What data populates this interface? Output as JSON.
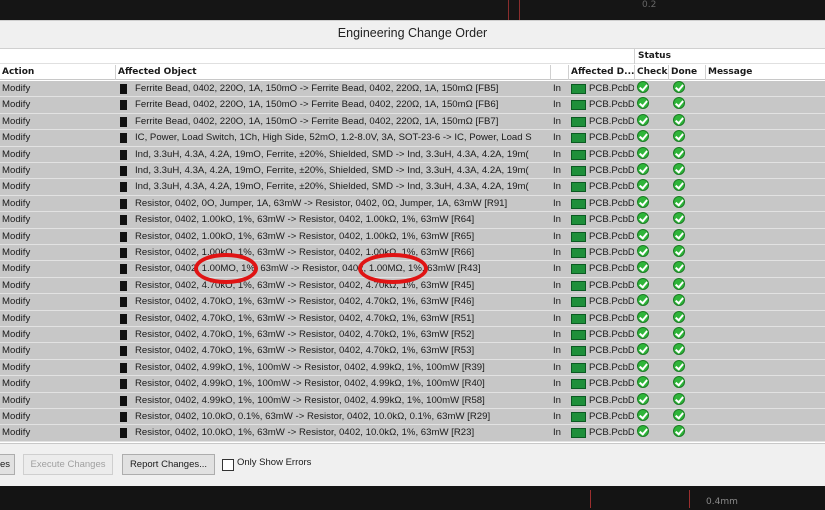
{
  "dialog": {
    "title": "Engineering Change Order",
    "header": {
      "status_group": "Status",
      "action": "Action",
      "affected_object": "Affected Object",
      "affected_document": "Affected D...",
      "check": "Check",
      "done": "Done",
      "message": "Message"
    },
    "rows": [
      {
        "action": "Modify",
        "object": "Ferrite Bead, 0402, 220O, 1A, 150mO -> Ferrite Bead, 0402, 220Ω, 1A, 150mΩ [FB5]",
        "in": "In",
        "doc": "PCB.PcbD"
      },
      {
        "action": "Modify",
        "object": "Ferrite Bead, 0402, 220O, 1A, 150mO -> Ferrite Bead, 0402, 220Ω, 1A, 150mΩ [FB6]",
        "in": "In",
        "doc": "PCB.PcbD"
      },
      {
        "action": "Modify",
        "object": "Ferrite Bead, 0402, 220O, 1A, 150mO -> Ferrite Bead, 0402, 220Ω, 1A, 150mΩ [FB7]",
        "in": "In",
        "doc": "PCB.PcbD"
      },
      {
        "action": "Modify",
        "object": "IC, Power, Load Switch, 1Ch, High Side, 52mO, 1.2-8.0V, 3A, SOT-23-6 -> IC, Power, Load S",
        "in": "In",
        "doc": "PCB.PcbD"
      },
      {
        "action": "Modify",
        "object": "Ind, 3.3uH, 4.3A, 4.2A, 19mO, Ferrite, ±20%, Shielded, SMD -> Ind, 3.3uH, 4.3A, 4.2A, 19m(",
        "in": "In",
        "doc": "PCB.PcbD"
      },
      {
        "action": "Modify",
        "object": "Ind, 3.3uH, 4.3A, 4.2A, 19mO, Ferrite, ±20%, Shielded, SMD -> Ind, 3.3uH, 4.3A, 4.2A, 19m(",
        "in": "In",
        "doc": "PCB.PcbD"
      },
      {
        "action": "Modify",
        "object": "Ind, 3.3uH, 4.3A, 4.2A, 19mO, Ferrite, ±20%, Shielded, SMD -> Ind, 3.3uH, 4.3A, 4.2A, 19m(",
        "in": "In",
        "doc": "PCB.PcbD"
      },
      {
        "action": "Modify",
        "object": "Resistor, 0402, 0O, Jumper, 1A, 63mW -> Resistor, 0402, 0Ω, Jumper, 1A, 63mW [R91]",
        "in": "In",
        "doc": "PCB.PcbD"
      },
      {
        "action": "Modify",
        "object": "Resistor, 0402, 1.00kO, 1%, 63mW -> Resistor, 0402, 1.00kΩ, 1%, 63mW [R64]",
        "in": "In",
        "doc": "PCB.PcbD"
      },
      {
        "action": "Modify",
        "object": "Resistor, 0402, 1.00kO, 1%, 63mW -> Resistor, 0402, 1.00kΩ, 1%, 63mW [R65]",
        "in": "In",
        "doc": "PCB.PcbD"
      },
      {
        "action": "Modify",
        "object": "Resistor, 0402, 1.00kO, 1%, 63mW -> Resistor, 0402, 1.00kΩ, 1%, 63mW [R66]",
        "in": "In",
        "doc": "PCB.PcbD"
      },
      {
        "action": "Modify",
        "object": "Resistor, 0402, 1.00MO, 1%, 63mW -> Resistor, 0402, 1.00MΩ, 1%, 63mW [R43]",
        "in": "In",
        "doc": "PCB.PcbD"
      },
      {
        "action": "Modify",
        "object": "Resistor, 0402, 4.70kO, 1%, 63mW -> Resistor, 0402, 4.70kΩ, 1%, 63mW [R45]",
        "in": "In",
        "doc": "PCB.PcbD"
      },
      {
        "action": "Modify",
        "object": "Resistor, 0402, 4.70kO, 1%, 63mW -> Resistor, 0402, 4.70kΩ, 1%, 63mW [R46]",
        "in": "In",
        "doc": "PCB.PcbD"
      },
      {
        "action": "Modify",
        "object": "Resistor, 0402, 4.70kO, 1%, 63mW -> Resistor, 0402, 4.70kΩ, 1%, 63mW [R51]",
        "in": "In",
        "doc": "PCB.PcbD"
      },
      {
        "action": "Modify",
        "object": "Resistor, 0402, 4.70kO, 1%, 63mW -> Resistor, 0402, 4.70kΩ, 1%, 63mW [R52]",
        "in": "In",
        "doc": "PCB.PcbD"
      },
      {
        "action": "Modify",
        "object": "Resistor, 0402, 4.70kO, 1%, 63mW -> Resistor, 0402, 4.70kΩ, 1%, 63mW [R53]",
        "in": "In",
        "doc": "PCB.PcbD"
      },
      {
        "action": "Modify",
        "object": "Resistor, 0402, 4.99kO, 1%, 100mW -> Resistor, 0402, 4.99kΩ, 1%, 100mW [R39]",
        "in": "In",
        "doc": "PCB.PcbD"
      },
      {
        "action": "Modify",
        "object": "Resistor, 0402, 4.99kO, 1%, 100mW -> Resistor, 0402, 4.99kΩ, 1%, 100mW [R40]",
        "in": "In",
        "doc": "PCB.PcbD"
      },
      {
        "action": "Modify",
        "object": "Resistor, 0402, 4.99kO, 1%, 100mW -> Resistor, 0402, 4.99kΩ, 1%, 100mW [R58]",
        "in": "In",
        "doc": "PCB.PcbD"
      },
      {
        "action": "Modify",
        "object": "Resistor, 0402, 10.0kO, 0.1%, 63mW -> Resistor, 0402, 10.0kΩ, 0.1%, 63mW [R29]",
        "in": "In",
        "doc": "PCB.PcbD"
      },
      {
        "action": "Modify",
        "object": "Resistor, 0402, 10.0kO, 1%, 63mW -> Resistor, 0402, 10.0kΩ, 1%, 63mW [R23]",
        "in": "In",
        "doc": "PCB.PcbD"
      }
    ],
    "buttons": {
      "validate_partial": "es",
      "execute": "Execute Changes",
      "report": "Report Changes...",
      "only_errors": "Only Show Errors"
    }
  },
  "pcb": {
    "top_label": "0.2",
    "bottom_label": "0.4mm"
  },
  "colors": {
    "row_bg": "#c7c7c7",
    "ok_green": "#2fb53a",
    "annotation_red": "#e01414"
  }
}
